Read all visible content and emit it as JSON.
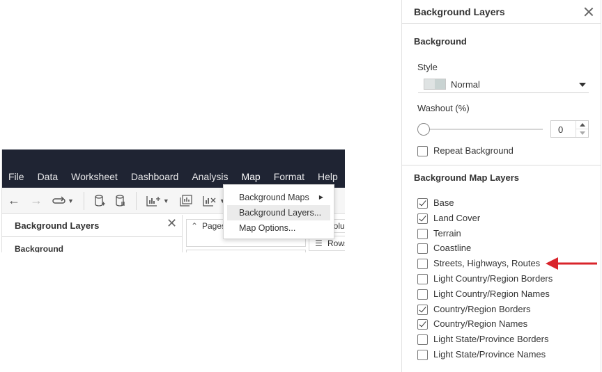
{
  "app": {
    "menu": [
      "File",
      "Data",
      "Worksheet",
      "Dashboard",
      "Analysis",
      "Map",
      "Format",
      "Help"
    ],
    "active_menu": "Map",
    "toolbar_icons": [
      "back-arrow-icon",
      "forward-arrow-icon",
      "redo-loop-icon",
      "caret-down-icon",
      "new-datasource-icon",
      "pause-updates-icon",
      "new-worksheet-icon",
      "duplicate-sheet-icon",
      "clear-sheet-icon",
      "highlight-icon"
    ],
    "left_panel": {
      "title": "Background Layers",
      "subtitle": "Background"
    },
    "shelves": {
      "pages": "Pages",
      "columns": "Colum",
      "rows": "Rows"
    },
    "map_menu_items": [
      {
        "label": "Background Maps",
        "has_submenu": true
      },
      {
        "label": "Background Layers...",
        "highlighted": true
      },
      {
        "label": "Map Options..."
      }
    ]
  },
  "panel": {
    "title": "Background Layers",
    "background_section": "Background",
    "style_label": "Style",
    "style_value": "Normal",
    "washout_label": "Washout (%)",
    "washout_value": "0",
    "washout_fraction": 0,
    "repeat_background": {
      "label": "Repeat Background",
      "checked": false
    },
    "map_layers_section": "Background Map Layers",
    "layers": [
      {
        "label": "Base",
        "checked": true
      },
      {
        "label": "Land Cover",
        "checked": true
      },
      {
        "label": "Terrain",
        "checked": false
      },
      {
        "label": "Coastline",
        "checked": false
      },
      {
        "label": "Streets, Highways, Routes",
        "checked": false
      },
      {
        "label": "Light Country/Region Borders",
        "checked": false
      },
      {
        "label": "Light Country/Region Names",
        "checked": false
      },
      {
        "label": "Country/Region Borders",
        "checked": true
      },
      {
        "label": "Country/Region Names",
        "checked": true
      },
      {
        "label": "Light State/Province Borders",
        "checked": false
      },
      {
        "label": "Light State/Province Names",
        "checked": false
      }
    ]
  },
  "annotation": {
    "arrow_color": "#d9242b",
    "points_to": "Streets, Highways, Routes"
  },
  "colors": {
    "menubar_bg": "#1f2433",
    "menu_highlight": "#ebebeb"
  }
}
